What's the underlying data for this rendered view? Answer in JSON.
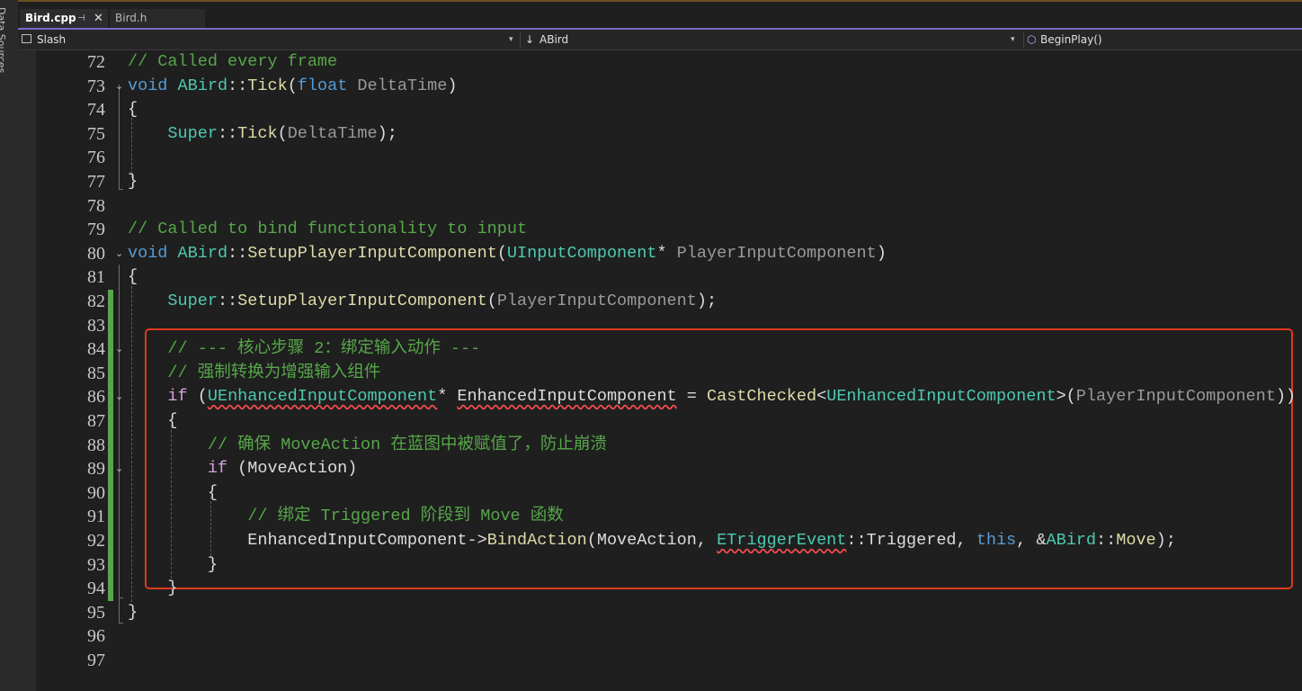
{
  "colors": {
    "background": "#1f1f1f",
    "comment": "#57a64a",
    "keyword": "#569cd6",
    "control": "#d8a0df",
    "type": "#4ec9b0",
    "function": "#dcdcaa",
    "parameter": "#9a9a9a",
    "plain": "#dcdcdc",
    "annotation_box": "#e0391c",
    "change_bar": "#57a64a"
  },
  "side_panel": {
    "label": "Data Sources"
  },
  "tabs": [
    {
      "label": "Bird.cpp",
      "active": true,
      "pin_icon": "pin-icon",
      "close_icon": "close-icon"
    },
    {
      "label": "Bird.h",
      "active": false
    }
  ],
  "navbar": {
    "project": {
      "icon": "project-icon",
      "label": "Slash"
    },
    "scope": {
      "icon": "scope-arrow-icon",
      "label": "ABird"
    },
    "member": {
      "icon": "method-cube-icon",
      "label": "BeginPlay()"
    }
  },
  "code": {
    "lines": [
      {
        "num": "72",
        "tokens": [
          [
            "// Called every frame",
            "c"
          ]
        ]
      },
      {
        "num": "73",
        "fold": true,
        "tokens": [
          [
            "void",
            "k"
          ],
          [
            " ",
            "p"
          ],
          [
            "ABird",
            "t"
          ],
          [
            "::",
            "p"
          ],
          [
            "Tick",
            "f"
          ],
          [
            "(",
            "p"
          ],
          [
            "float",
            "k"
          ],
          [
            " DeltaTime",
            "g"
          ],
          [
            ")",
            "p"
          ]
        ]
      },
      {
        "num": "74",
        "tokens": [
          [
            "{",
            "p"
          ]
        ]
      },
      {
        "num": "75",
        "tokens": [
          [
            "    ",
            "p"
          ],
          [
            "Super",
            "t"
          ],
          [
            "::",
            "p"
          ],
          [
            "Tick",
            "f"
          ],
          [
            "(",
            "p"
          ],
          [
            "DeltaTime",
            "g"
          ],
          [
            ");",
            "p"
          ]
        ]
      },
      {
        "num": "76",
        "tokens": []
      },
      {
        "num": "77",
        "tokens": [
          [
            "}",
            "p"
          ]
        ]
      },
      {
        "num": "78",
        "tokens": []
      },
      {
        "num": "79",
        "tokens": [
          [
            "// Called to bind functionality to input",
            "c"
          ]
        ]
      },
      {
        "num": "80",
        "fold": true,
        "tokens": [
          [
            "void",
            "k"
          ],
          [
            " ",
            "p"
          ],
          [
            "ABird",
            "t"
          ],
          [
            "::",
            "p"
          ],
          [
            "SetupPlayerInputComponent",
            "f"
          ],
          [
            "(",
            "p"
          ],
          [
            "UInputComponent",
            "t"
          ],
          [
            "* ",
            "p"
          ],
          [
            "PlayerInputComponent",
            "g"
          ],
          [
            ")",
            "p"
          ]
        ]
      },
      {
        "num": "81",
        "tokens": [
          [
            "{",
            "p"
          ]
        ]
      },
      {
        "num": "82",
        "changed": true,
        "tokens": [
          [
            "    ",
            "p"
          ],
          [
            "Super",
            "t"
          ],
          [
            "::",
            "p"
          ],
          [
            "SetupPlayerInputComponent",
            "f"
          ],
          [
            "(",
            "p"
          ],
          [
            "PlayerInputComponent",
            "g"
          ],
          [
            ");",
            "p"
          ]
        ]
      },
      {
        "num": "83",
        "changed": true,
        "tokens": []
      },
      {
        "num": "84",
        "changed": true,
        "fold": true,
        "tokens": [
          [
            "    // --- 核心步骤 2：绑定输入动作 ---",
            "c"
          ]
        ]
      },
      {
        "num": "85",
        "changed": true,
        "tokens": [
          [
            "    // 强制转换为增强输入组件",
            "c"
          ]
        ]
      },
      {
        "num": "86",
        "changed": true,
        "fold": true,
        "tokens": [
          [
            "    ",
            "p"
          ],
          [
            "if",
            "m"
          ],
          [
            " (",
            "p"
          ],
          [
            "UEnhancedInputComponent",
            "ts"
          ],
          [
            "* ",
            "p"
          ],
          [
            "EnhancedInputComponent",
            "ps"
          ],
          [
            " = ",
            "p"
          ],
          [
            "CastChecked",
            "f"
          ],
          [
            "<",
            "p"
          ],
          [
            "UEnhancedInputComponent",
            "t"
          ],
          [
            ">(",
            "p"
          ],
          [
            "PlayerInputComponent",
            "g"
          ],
          [
            "))",
            "p"
          ]
        ]
      },
      {
        "num": "87",
        "changed": true,
        "tokens": [
          [
            "    {",
            "p"
          ]
        ]
      },
      {
        "num": "88",
        "changed": true,
        "tokens": [
          [
            "        // 确保 MoveAction 在蓝图中被赋值了，防止崩溃",
            "c"
          ]
        ]
      },
      {
        "num": "89",
        "changed": true,
        "fold": true,
        "tokens": [
          [
            "        ",
            "p"
          ],
          [
            "if",
            "m"
          ],
          [
            " (MoveAction)",
            "p"
          ]
        ]
      },
      {
        "num": "90",
        "changed": true,
        "tokens": [
          [
            "        {",
            "p"
          ]
        ]
      },
      {
        "num": "91",
        "changed": true,
        "tokens": [
          [
            "            // 绑定 Triggered 阶段到 Move 函数",
            "c"
          ]
        ]
      },
      {
        "num": "92",
        "changed": true,
        "tokens": [
          [
            "            ",
            "p"
          ],
          [
            "EnhancedInputComponent",
            "p"
          ],
          [
            "->",
            "p"
          ],
          [
            "BindAction",
            "f"
          ],
          [
            "(MoveAction, ",
            "p"
          ],
          [
            "ETriggerEvent",
            "ts"
          ],
          [
            "::",
            "p"
          ],
          [
            "Triggered",
            "p"
          ],
          [
            ", ",
            "p"
          ],
          [
            "this",
            "k"
          ],
          [
            ", &",
            "p"
          ],
          [
            "ABird",
            "t"
          ],
          [
            "::",
            "p"
          ],
          [
            "Move",
            "f"
          ],
          [
            ");",
            "p"
          ]
        ]
      },
      {
        "num": "93",
        "changed": true,
        "tokens": [
          [
            "        }",
            "p"
          ]
        ]
      },
      {
        "num": "94",
        "changed": true,
        "tokens": [
          [
            "    }",
            "p"
          ]
        ]
      },
      {
        "num": "95",
        "tokens": [
          [
            "}",
            "p"
          ]
        ]
      },
      {
        "num": "96",
        "tokens": []
      },
      {
        "num": "97",
        "tokens": []
      }
    ]
  }
}
